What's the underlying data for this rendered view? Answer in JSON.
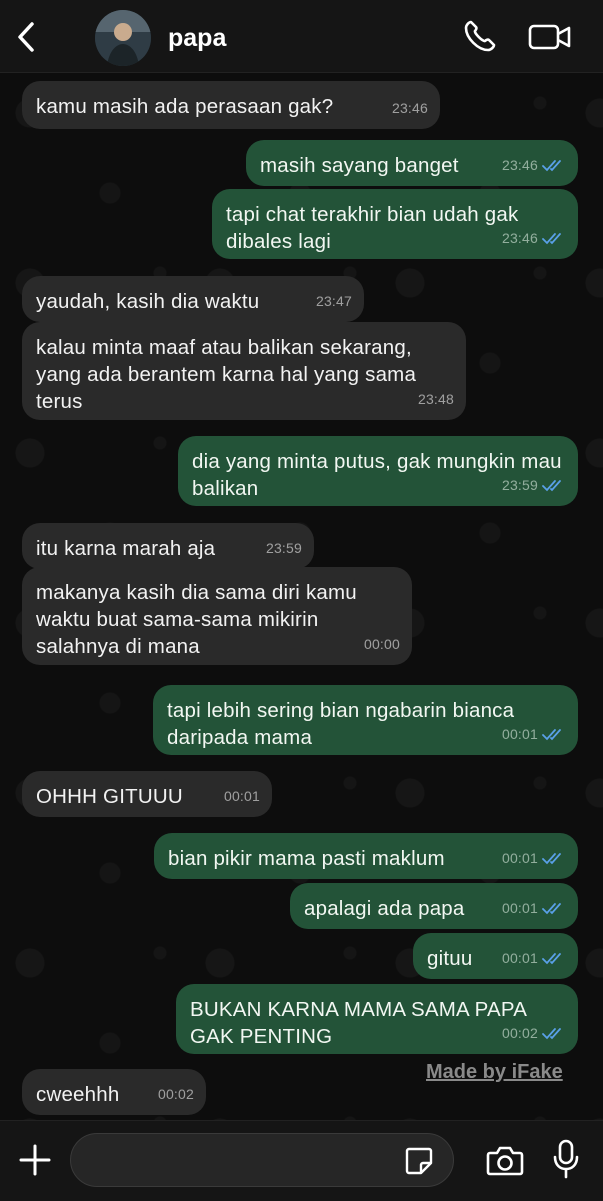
{
  "header": {
    "contact_name": "papa"
  },
  "messages": [
    {
      "dir": "in",
      "text": "kamu masih ada perasaan gak?",
      "time": "23:46"
    },
    {
      "dir": "out",
      "text": "masih sayang banget",
      "time": "23:46"
    },
    {
      "dir": "out",
      "text": "tapi chat terakhir bian udah gak dibales lagi",
      "time": "23:46"
    },
    {
      "dir": "in",
      "text": "yaudah, kasih dia waktu",
      "time": "23:47"
    },
    {
      "dir": "in",
      "text": "kalau minta maaf atau balikan sekarang, yang ada berantem karna hal yang sama terus",
      "time": "23:48"
    },
    {
      "dir": "out",
      "text": "dia yang minta putus, gak mungkin mau balikan",
      "time": "23:59"
    },
    {
      "dir": "in",
      "text": "itu karna marah aja",
      "time": "23:59"
    },
    {
      "dir": "in",
      "text": "makanya kasih dia sama diri kamu waktu buat sama-sama mikirin salahnya di mana",
      "time": "00:00"
    },
    {
      "dir": "out",
      "text": "tapi lebih sering bian ngabarin bianca daripada mama",
      "time": "00:01"
    },
    {
      "dir": "in",
      "text": "OHHH GITUUU",
      "time": "00:01"
    },
    {
      "dir": "out",
      "text": "bian pikir mama pasti maklum",
      "time": "00:01"
    },
    {
      "dir": "out",
      "text": "apalagi ada papa",
      "time": "00:01"
    },
    {
      "dir": "out",
      "text": "gituu",
      "time": "00:01"
    },
    {
      "dir": "out",
      "text": "BUKAN KARNA MAMA SAMA PAPA GAK PENTING",
      "time": "00:02"
    },
    {
      "dir": "in",
      "text": "cweehhh",
      "time": "00:02"
    }
  ],
  "watermark": "Made by iFake",
  "composer": {
    "placeholder": ""
  },
  "icons": {
    "back": "chevron-left-icon",
    "call": "phone-icon",
    "video": "video-camera-icon",
    "read": "double-check-icon",
    "plus": "plus-icon",
    "sticker": "sticker-icon",
    "camera": "camera-icon",
    "mic": "microphone-icon"
  },
  "colors": {
    "incoming_bubble": "#2a2a2a",
    "outgoing_bubble": "#235338",
    "read_tick": "#5aa0e8"
  }
}
